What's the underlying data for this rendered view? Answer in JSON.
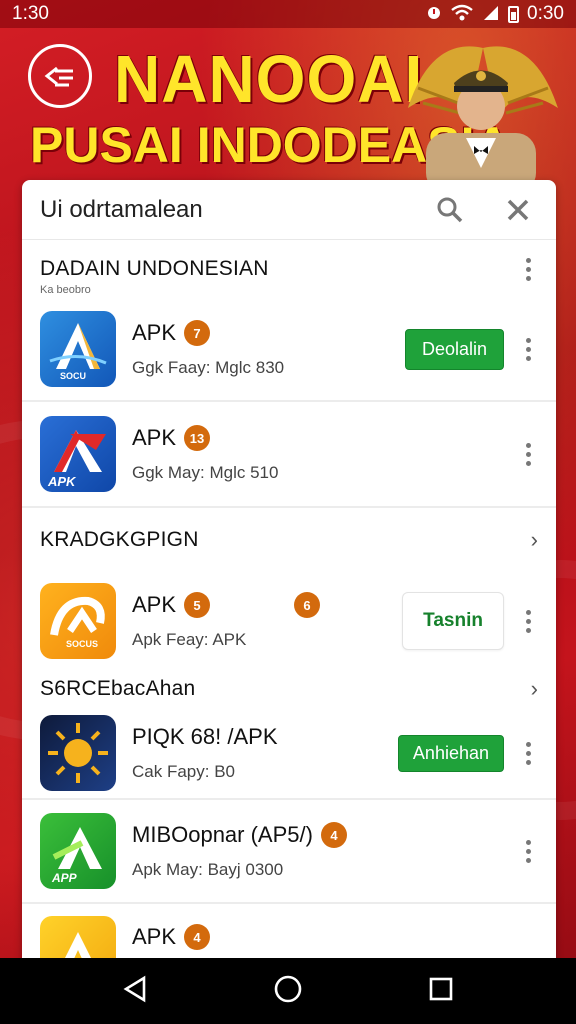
{
  "status_bar": {
    "time": "1:30",
    "right_time": "0:30"
  },
  "banner": {
    "title": "NANOOAI",
    "subtitle": "PUSAI INDODEASIA"
  },
  "search": {
    "text": "Ui odrtamalean"
  },
  "sections": [
    {
      "title": "DADAIN UNDONESIAN",
      "subtitle": "Ka beobro",
      "apps": [
        {
          "name": "APK",
          "badge": "7",
          "meta": "Ggk Faay: Mglc 830",
          "action": "Deolalin"
        },
        {
          "name": "APK",
          "badge": "13",
          "meta": "Ggk May: Mglc 510",
          "action": ""
        }
      ]
    },
    {
      "title": "KRADGKGPIGN",
      "apps": [
        {
          "name": "APK",
          "badge": "5",
          "badge2": "6",
          "meta": "Apk Feay: APK",
          "action": "Tasnin"
        }
      ]
    },
    {
      "title": "S6RCEbacAhan",
      "apps": [
        {
          "name": "PIQK 68! /APK",
          "meta": "Cak Fapy: B0",
          "action": "Anhiehan"
        },
        {
          "name": "MIBOopnar (AP5/)",
          "badge": "4",
          "meta": "Apk May: Bayj 0300",
          "action": ""
        },
        {
          "name": "APK",
          "badge": "4",
          "meta": "",
          "action": ""
        }
      ]
    }
  ],
  "icon_labels": {
    "app1": "SOCU",
    "app2": "APK",
    "app3": "SOCUS",
    "app5": "APP"
  },
  "colors": {
    "brand_red": "#c4141c",
    "accent_yellow": "#ffe52a",
    "install_green": "#1fa23a",
    "badge_orange": "#d36a0d"
  }
}
